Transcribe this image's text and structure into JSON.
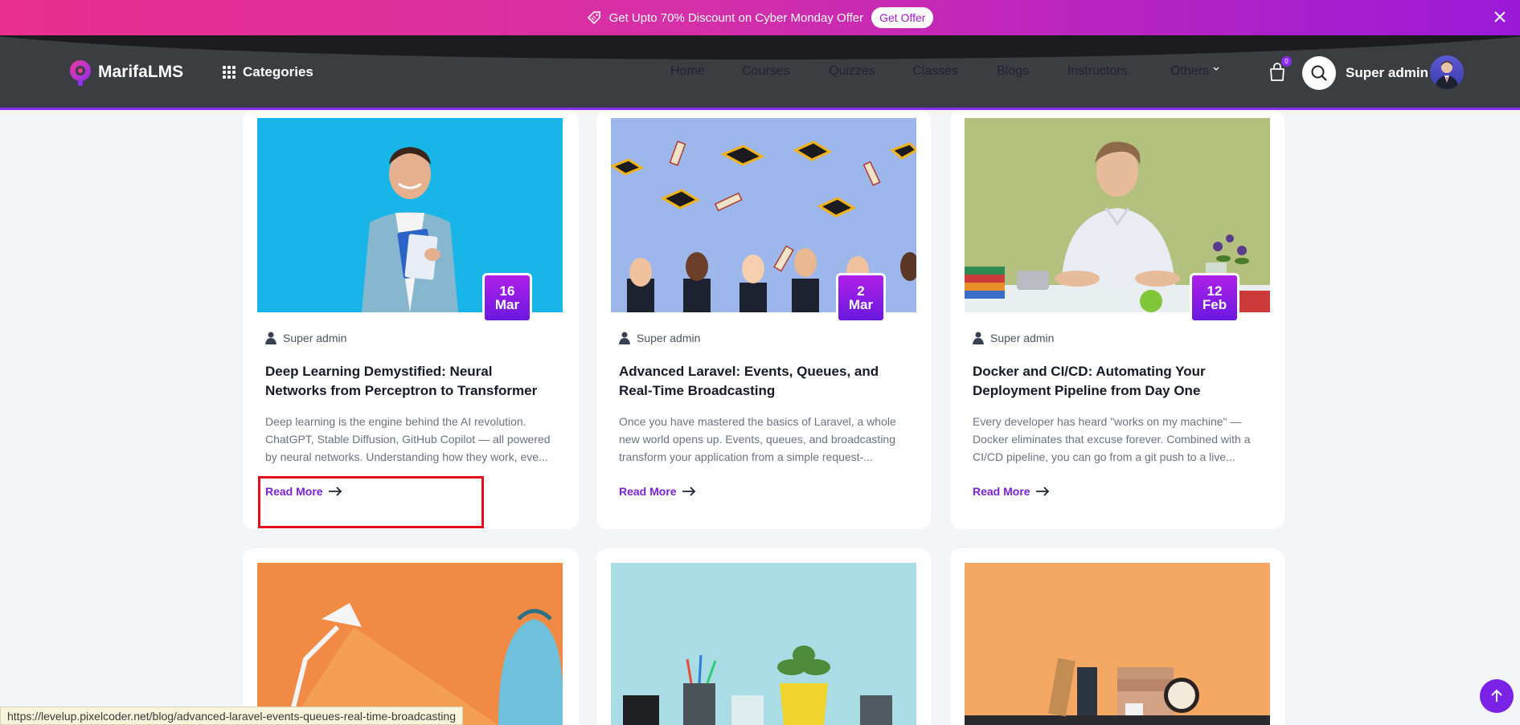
{
  "promo": {
    "text": "Get Upto 70% Discount on Cyber Monday Offer",
    "button": "Get Offer"
  },
  "header": {
    "logo": "MarifaLMS",
    "categories_label": "Categories",
    "nav": [
      "Home",
      "Courses",
      "Quizzes",
      "Classes",
      "Blogs",
      "Instructors",
      "Others"
    ],
    "cart_count": "0",
    "user_name": "Super admin"
  },
  "cards": [
    {
      "day": "16",
      "month": "Mar",
      "author": "Super admin",
      "title": "Deep Learning Demystified: Neural Networks from Perceptron to Transformer",
      "excerpt": "Deep learning is the engine behind the AI revolution. ChatGPT, Stable Diffusion, GitHub Copilot — all powered by neural networks. Understanding how they work, eve...",
      "read_more": "Read More"
    },
    {
      "day": "2",
      "month": "Mar",
      "author": "Super admin",
      "title": "Advanced Laravel: Events, Queues, and Real-Time Broadcasting",
      "excerpt": "Once you have mastered the basics of Laravel, a whole new world opens up. Events, queues, and broadcasting transform your application from a simple request-...",
      "read_more": "Read More"
    },
    {
      "day": "12",
      "month": "Feb",
      "author": "Super admin",
      "title": "Docker and CI/CD: Automating Your Deployment Pipeline from Day One",
      "excerpt": "Every developer has heard \"works on my machine\" — Docker eliminates that excuse forever. Combined with a CI/CD pipeline, you can go from a git push to a live...",
      "read_more": "Read More"
    }
  ],
  "status_url": "https://levelup.pixelcoder.net/blog/advanced-laravel-events-queues-real-time-broadcasting",
  "colors": {
    "accent": "#7b1fd9",
    "promo_start": "#ea2f8e",
    "promo_end": "#9a1ad8",
    "header_bg": "#3c3d41",
    "highlight": "#e30d1b"
  }
}
